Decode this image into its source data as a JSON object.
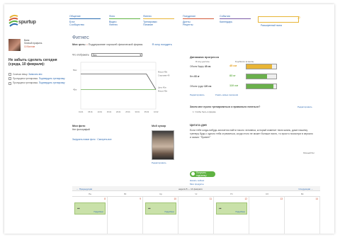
{
  "brand": {
    "name": "spurtup"
  },
  "nav": [
    {
      "label": "Общение",
      "color": "#2b6cb0",
      "items": [
        "Блог",
        "Сообщество"
      ]
    },
    {
      "label": "Фото",
      "color": "#5fb342",
      "items": [
        "Видео",
        "Фитнес"
      ]
    },
    {
      "label": "Фитнес",
      "color": "#e8b536",
      "items": [
        "Тренировки",
        "Питание"
      ]
    },
    {
      "label": "Похудение",
      "color": "#d35b3a",
      "items": [
        "Диеты",
        "Рецепты"
      ]
    },
    {
      "label": "События",
      "color": "#7b5aa6",
      "items": [
        "Календарь"
      ]
    }
  ],
  "search": {
    "placeholder": "",
    "link": "Расширенный поиск"
  },
  "user": {
    "name": "Ваня",
    "line2": "Личный профиль",
    "line3": "10 баллов"
  },
  "reminder": {
    "title": "Не забыть сделать сегодня (среда, 10 февраля):",
    "items": [
      {
        "text": "Сколько вешу. ",
        "link": "Записать вес"
      },
      {
        "text": "Пропущена тренировка. ",
        "link": "Подтвердить тренировку"
      },
      {
        "text": "Пропущена тренировка. ",
        "link": "Подтвердить тренировку"
      }
    ]
  },
  "main": {
    "title": "Фитнес",
    "goal_label": "Моя цель:",
    "goal_value": "Поддержание хорошей физической формы",
    "goal_link": "Я хочу похудеть",
    "show_label": "Что отображать:",
    "show_value": "Вес"
  },
  "chart_data": {
    "type": "line",
    "x": [
      "01.01",
      "05.01",
      "10.01",
      "15.01",
      "20.01",
      "25.01",
      "30.01",
      "05.02",
      "10.02"
    ],
    "series": [
      {
        "name": "Вес",
        "color": "#555555",
        "values": [
          49,
          49,
          49,
          49,
          49,
          49,
          49,
          49,
          45
        ]
      },
      {
        "name": "Цель",
        "color": "#6ab04c",
        "values": [
          45,
          45,
          45,
          45,
          45,
          45,
          45,
          45,
          45
        ]
      }
    ],
    "ylim": [
      40,
      52
    ],
    "y_ticks": [
      "50кг",
      "45кг"
    ],
    "right_labels": [
      "Масса 49кг",
      "Стартовая 49",
      "Цель 45кг",
      "Масса 45кг"
    ]
  },
  "progress": {
    "title": "Динамика прогресса",
    "col_start": "Я хочу достичь:",
    "col_goal": "Я добился за месяц:",
    "rows": [
      {
        "label": "Объем бедер",
        "value": "45 см",
        "delta": "45 см",
        "fill": 0.85,
        "color": "#e8b536",
        "delta_class": "orange"
      },
      {
        "label": "Вес",
        "value": "83 кг",
        "delta": "83 кг",
        "fill": 0.7,
        "color": "#6ab04c",
        "delta_class": "green"
      },
      {
        "label": "Объем груди",
        "value": "120 см",
        "delta": "110 см",
        "fill": 0.9,
        "color": "#6ab04c",
        "delta_class": "green"
      }
    ],
    "links": [
      "Редактировать",
      "Узнать новые значения"
    ]
  },
  "question": {
    "title": "Зачем мне нужно тренироваться и правильно питаться?",
    "link": "Редактировать",
    "item": "1. Чтобы быть в форме"
  },
  "quote": {
    "title": "Цитата дня",
    "text": "Если тебе когда-нибудь захочется найти такого человека, который изменит твою жизнь, даже нашему тренеру будь с одного тебя стремиться, когда этого не может больше никто, то просто посмотри в зеркало и скажи: \"Привет!\"",
    "author": "Личный бег"
  },
  "photos": {
    "title": "Мои фото",
    "subtitle": "Нет фотографий",
    "link": "Загрузить новое фото · Смотреть все"
  },
  "mybody": {
    "title": "Мой кумир",
    "link": "Редактировать"
  },
  "tip": {
    "button": "Получить подсказку",
    "links": [
      "Начать сейчас",
      "Мои продукты"
    ]
  },
  "calendar": {
    "prev": "← Предыдущая",
    "week": "неделя 8 — 14 февраля",
    "next": "Следующая →",
    "days": [
      "Пн",
      "Вт",
      "Ср",
      "Чт",
      "Пт",
      "Сб",
      "Вс"
    ],
    "nums": [
      "8",
      "9",
      "10",
      "11",
      "12",
      "13",
      "14"
    ],
    "events": [
      0,
      2,
      4
    ],
    "event_link": "Подробнее"
  }
}
